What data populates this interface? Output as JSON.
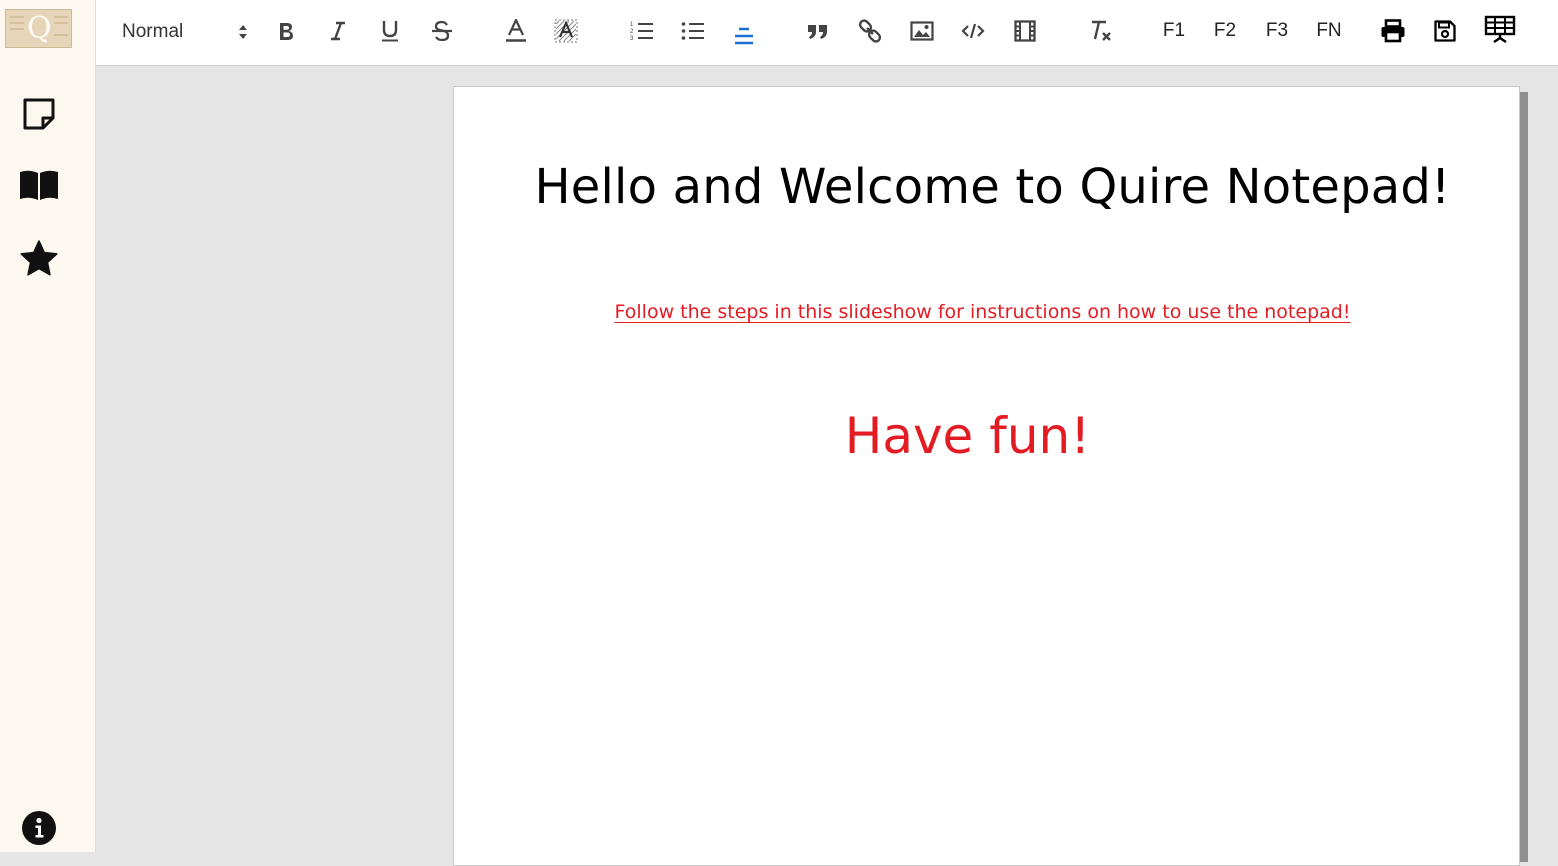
{
  "app": {
    "logo_letter": "Q"
  },
  "toolbar": {
    "format_select": "Normal",
    "font_buttons": [
      "F1",
      "F2",
      "F3",
      "FN"
    ]
  },
  "icons": {
    "sidebar": [
      "note-icon",
      "book-icon",
      "star-icon",
      "info-icon"
    ],
    "toolbar": [
      "bold-icon",
      "italic-icon",
      "underline-icon",
      "strikethrough-icon",
      "font-color-icon",
      "highlight-icon",
      "ordered-list-icon",
      "bullet-list-icon",
      "align-center-icon",
      "blockquote-icon",
      "link-icon",
      "image-icon",
      "code-icon",
      "video-icon",
      "clear-format-icon",
      "print-icon",
      "save-icon",
      "slideshow-icon"
    ]
  },
  "colors": {
    "accent_blue": "#1a6fd6",
    "text_red": "#e31c23",
    "sidebar_bg": "#fdf8ef"
  },
  "document": {
    "title": "Hello and Welcome to Quire Notepad!",
    "link_text": "Follow the steps in this slideshow for instructions on how to use the notepad!",
    "closing": "Have fun!"
  }
}
